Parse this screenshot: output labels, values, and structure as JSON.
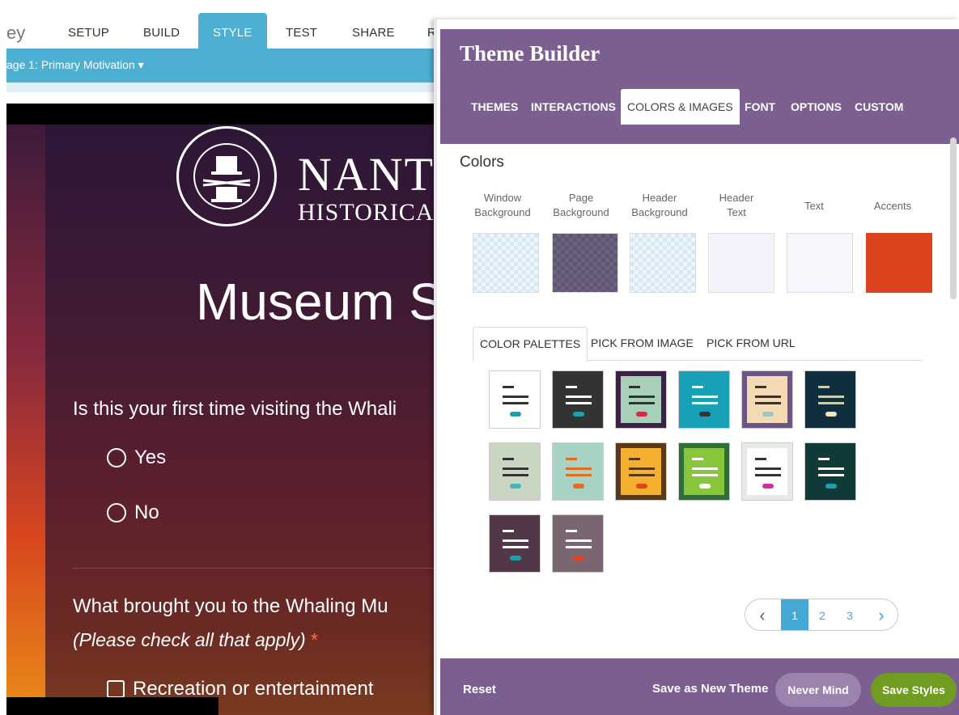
{
  "topnav": {
    "brand_partial": "ey",
    "items": [
      "SETUP",
      "BUILD",
      "STYLE",
      "TEST",
      "SHARE",
      "R"
    ]
  },
  "pagebar": {
    "page_label": "age 1: Primary Motivation ▾"
  },
  "survey": {
    "org_name_partial": "NANT",
    "org_sub_partial": "HISTORICAL",
    "title_partial": "Museum S",
    "q1": "Is this your first time visiting the Whali",
    "q1_options": [
      "Yes",
      "No"
    ],
    "q2": "What brought you to the Whaling Mu",
    "q2_note": "(Please check all that apply)",
    "q2_required": "*",
    "q2_options": [
      "Recreation or entertainment"
    ]
  },
  "theme_builder": {
    "title": "Theme Builder",
    "tabs": [
      "THEMES",
      "INTERACTIONS",
      "COLORS & IMAGES",
      "FONT",
      "OPTIONS",
      "CUSTOM"
    ],
    "active_tab": "COLORS & IMAGES",
    "colors_heading": "Colors",
    "swatches": [
      {
        "label1": "Window",
        "label2": "Background",
        "style": "checker",
        "color": "#eef6fb"
      },
      {
        "label1": "Page",
        "label2": "Background",
        "style": "darkcheck",
        "color": "#5f5572"
      },
      {
        "label1": "Header",
        "label2": "Background",
        "style": "checker",
        "color": "#eef6fb"
      },
      {
        "label1": "Header",
        "label2": "Text",
        "style": "solid",
        "color": "#f3f3fb"
      },
      {
        "label1": "Text",
        "label2": "",
        "style": "solid",
        "color": "#f6f7fd"
      },
      {
        "label1": "Accents",
        "label2": "",
        "style": "solid",
        "color": "#d9441c"
      }
    ],
    "subtabs": [
      "COLOR PALETTES",
      "PICK FROM IMAGE",
      "PICK FROM URL"
    ],
    "palettes": [
      {
        "name": "palette-1",
        "bg": "#ffffff",
        "card": "#ffffff",
        "line": "#333333",
        "accent": "#1aa1b0"
      },
      {
        "name": "palette-2",
        "bg": "#333333",
        "card": "#333333",
        "line": "#ffffff",
        "accent": "#1aa1b0"
      },
      {
        "name": "palette-3",
        "bg": "#3a2145",
        "card": "#a8d0b8",
        "line": "#333333",
        "accent": "#e02348"
      },
      {
        "name": "palette-4",
        "bg": "#18a0b4",
        "card": "#18a0b4",
        "line": "#ffffff",
        "accent": "#333333"
      },
      {
        "name": "palette-5",
        "bg": "#6b5586",
        "card": "#f3d9b4",
        "line": "#333333",
        "accent": "#9fc7c2"
      },
      {
        "name": "palette-6",
        "bg": "#0f2f3f",
        "card": "#0f2f3f",
        "line": "#e0c88a",
        "accent": "#f4e3c0"
      },
      {
        "name": "palette-7",
        "bg": "#c8d6c2",
        "card": "#c8d6c2",
        "line": "#333333",
        "accent": "#44b4c0"
      },
      {
        "name": "palette-8",
        "bg": "#a7d3c4",
        "card": "#a7d3c4",
        "line": "#e36c20",
        "accent": "#e36c20"
      },
      {
        "name": "palette-9",
        "bg": "#5a3818",
        "card": "#f5b12e",
        "line": "#5a3818",
        "accent": "#e4441c"
      },
      {
        "name": "palette-10",
        "bg": "#2e6e3a",
        "card": "#88c63c",
        "line": "#ffffff",
        "accent": "#ffffff"
      },
      {
        "name": "palette-11",
        "bg": "#e8e8e8",
        "card": "#ffffff",
        "line": "#333333",
        "accent": "#d02f9b"
      },
      {
        "name": "palette-12",
        "bg": "#0f3a38",
        "card": "#0f3a38",
        "line": "#ffffff",
        "accent": "#1aa1b0"
      },
      {
        "name": "palette-13",
        "bg": "#513747",
        "card": "#513747",
        "line": "#ffffff",
        "accent": "#1aa1b0"
      },
      {
        "name": "palette-14",
        "bg": "#7a6672",
        "card": "#7a6672",
        "line": "#ffffff",
        "accent": "#e4441c"
      }
    ],
    "pager": {
      "prev": "‹",
      "pages": [
        "1",
        "2",
        "3"
      ],
      "active": "1",
      "next": "›"
    },
    "footer": {
      "reset": "Reset",
      "save_new": "Save as New Theme",
      "never_mind": "Never Mind",
      "save_styles": "Save Styles"
    }
  }
}
